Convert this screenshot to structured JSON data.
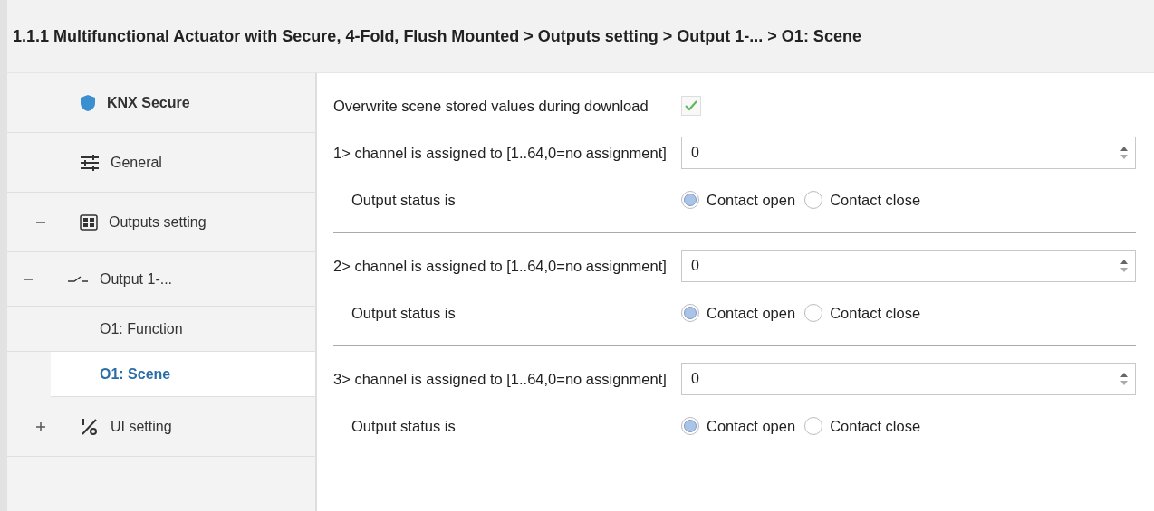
{
  "title": "1.1.1 Multifunctional Actuator with Secure, 4-Fold, Flush Mounted > Outputs setting > Output 1-... > O1: Scene",
  "sidebar": {
    "items": [
      {
        "label": "KNX Secure",
        "selected": false
      },
      {
        "label": "General",
        "selected": false
      },
      {
        "label": "Outputs setting",
        "selected": false,
        "expanded": true,
        "children": [
          {
            "label": "Output 1-...",
            "selected": false,
            "expanded": true,
            "children": [
              {
                "label": "O1: Function",
                "selected": false
              },
              {
                "label": "O1: Scene",
                "selected": true
              }
            ]
          }
        ]
      },
      {
        "label": "UI setting",
        "selected": false,
        "expanded": false
      }
    ]
  },
  "overwrite": {
    "label": "Overwrite scene stored values during download",
    "checked": true
  },
  "channels": [
    {
      "label": "1> channel is assigned to [1..64,0=no assignment]",
      "value": "0",
      "status_label": "Output status is",
      "options": [
        {
          "label": "Contact open",
          "selected": true
        },
        {
          "label": "Contact close",
          "selected": false
        }
      ]
    },
    {
      "label": "2> channel is assigned to [1..64,0=no assignment]",
      "value": "0",
      "status_label": "Output status is",
      "options": [
        {
          "label": "Contact open",
          "selected": true
        },
        {
          "label": "Contact close",
          "selected": false
        }
      ]
    },
    {
      "label": "3> channel is assigned to [1..64,0=no assignment]",
      "value": "0",
      "status_label": "Output status is",
      "options": [
        {
          "label": "Contact open",
          "selected": true
        },
        {
          "label": "Contact close",
          "selected": false
        }
      ]
    }
  ]
}
